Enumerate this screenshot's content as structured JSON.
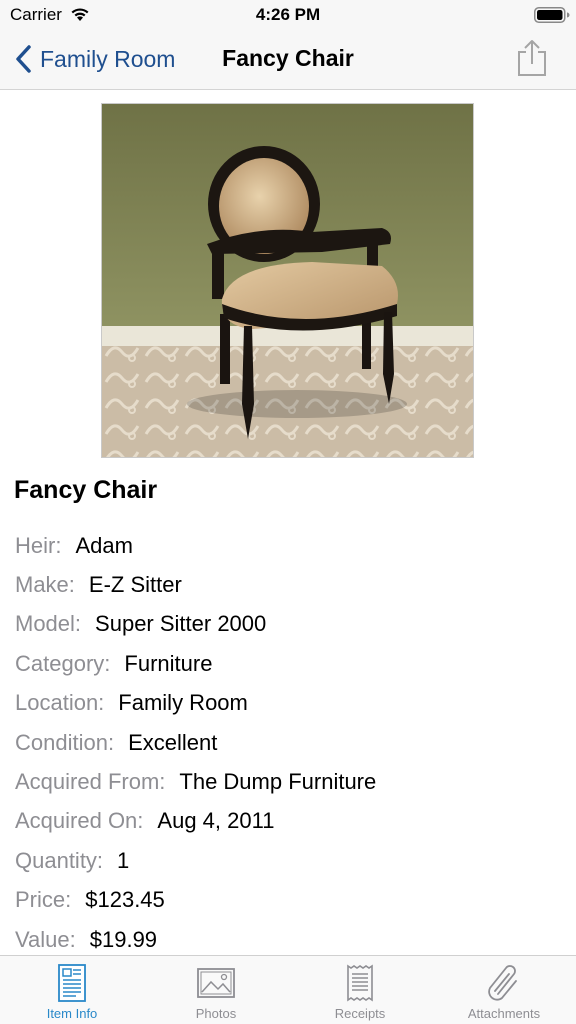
{
  "status_bar": {
    "carrier": "Carrier",
    "time": "4:26 PM"
  },
  "nav": {
    "back_label": "Family Room",
    "title": "Fancy Chair",
    "share_icon": "share-icon"
  },
  "item": {
    "title": "Fancy Chair",
    "photo_icon": "chair-photo",
    "fields": [
      {
        "label": "Heir:",
        "value": "Adam"
      },
      {
        "label": "Make:",
        "value": "E-Z Sitter"
      },
      {
        "label": "Model:",
        "value": "Super Sitter 2000"
      },
      {
        "label": "Category:",
        "value": "Furniture"
      },
      {
        "label": "Location:",
        "value": "Family Room"
      },
      {
        "label": "Condition:",
        "value": "Excellent"
      },
      {
        "label": "Acquired From:",
        "value": "The Dump Furniture"
      },
      {
        "label": "Acquired On:",
        "value": "Aug 4, 2011"
      },
      {
        "label": "Quantity:",
        "value": "1"
      },
      {
        "label": "Price:",
        "value": "$123.45"
      },
      {
        "label": "Value:",
        "value": "$19.99"
      }
    ]
  },
  "tabs": [
    {
      "label": "Item Info",
      "icon": "document-icon",
      "active": true
    },
    {
      "label": "Photos",
      "icon": "photo-icon",
      "active": false
    },
    {
      "label": "Receipts",
      "icon": "receipt-icon",
      "active": false
    },
    {
      "label": "Attachments",
      "icon": "paperclip-icon",
      "active": false
    }
  ],
  "colors": {
    "accent": "#2a89c9",
    "nav_link": "#1f4f8f",
    "label_gray": "#8e8e93"
  }
}
